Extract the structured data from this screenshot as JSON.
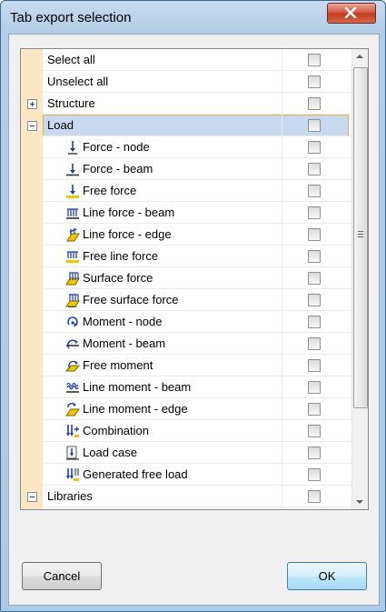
{
  "window": {
    "title": "Tab export selection",
    "close_icon": "close-x-icon"
  },
  "list": {
    "items": [
      {
        "label": "Select all",
        "level": 0,
        "toggle": "",
        "icon": "",
        "checked": false,
        "selected": false
      },
      {
        "label": "Unselect all",
        "level": 0,
        "toggle": "",
        "icon": "",
        "checked": false,
        "selected": false
      },
      {
        "label": "Structure",
        "level": 0,
        "toggle": "plus",
        "icon": "",
        "checked": false,
        "selected": false
      },
      {
        "label": "Load",
        "level": 0,
        "toggle": "minus",
        "icon": "",
        "checked": false,
        "selected": true
      },
      {
        "label": "Force - node",
        "level": 1,
        "toggle": "",
        "icon": "force-node-icon",
        "checked": false,
        "selected": false
      },
      {
        "label": "Force  - beam",
        "level": 1,
        "toggle": "",
        "icon": "force-beam-icon",
        "checked": false,
        "selected": false
      },
      {
        "label": "Free force",
        "level": 1,
        "toggle": "",
        "icon": "free-force-icon",
        "checked": false,
        "selected": false
      },
      {
        "label": "Line force - beam",
        "level": 1,
        "toggle": "",
        "icon": "line-force-beam-icon",
        "checked": false,
        "selected": false
      },
      {
        "label": "Line force - edge",
        "level": 1,
        "toggle": "",
        "icon": "line-force-edge-icon",
        "checked": false,
        "selected": false
      },
      {
        "label": "Free line force",
        "level": 1,
        "toggle": "",
        "icon": "free-line-force-icon",
        "checked": false,
        "selected": false
      },
      {
        "label": "Surface force",
        "level": 1,
        "toggle": "",
        "icon": "surface-force-icon",
        "checked": false,
        "selected": false
      },
      {
        "label": "Free surface force",
        "level": 1,
        "toggle": "",
        "icon": "free-surface-force-icon",
        "checked": false,
        "selected": false
      },
      {
        "label": "Moment - node",
        "level": 1,
        "toggle": "",
        "icon": "moment-node-icon",
        "checked": false,
        "selected": false
      },
      {
        "label": "Moment - beam",
        "level": 1,
        "toggle": "",
        "icon": "moment-beam-icon",
        "checked": false,
        "selected": false
      },
      {
        "label": "Free moment",
        "level": 1,
        "toggle": "",
        "icon": "free-moment-icon",
        "checked": false,
        "selected": false
      },
      {
        "label": "Line moment - beam",
        "level": 1,
        "toggle": "",
        "icon": "line-moment-beam-icon",
        "checked": false,
        "selected": false
      },
      {
        "label": "Line moment - edge",
        "level": 1,
        "toggle": "",
        "icon": "line-moment-edge-icon",
        "checked": false,
        "selected": false
      },
      {
        "label": "Combination",
        "level": 1,
        "toggle": "",
        "icon": "combination-icon",
        "checked": false,
        "selected": false
      },
      {
        "label": "Load case",
        "level": 1,
        "toggle": "",
        "icon": "load-case-icon",
        "checked": false,
        "selected": false
      },
      {
        "label": "Generated free load",
        "level": 1,
        "toggle": "",
        "icon": "generated-free-load-icon",
        "checked": false,
        "selected": false
      },
      {
        "label": "Libraries",
        "level": 0,
        "toggle": "minus",
        "icon": "",
        "checked": false,
        "selected": false
      }
    ]
  },
  "buttons": {
    "cancel": "Cancel",
    "ok": "OK"
  },
  "colors": {
    "selection_fill": "#c9daf0",
    "selection_border": "#e8b04c",
    "gutter": "#fbe7c3"
  }
}
